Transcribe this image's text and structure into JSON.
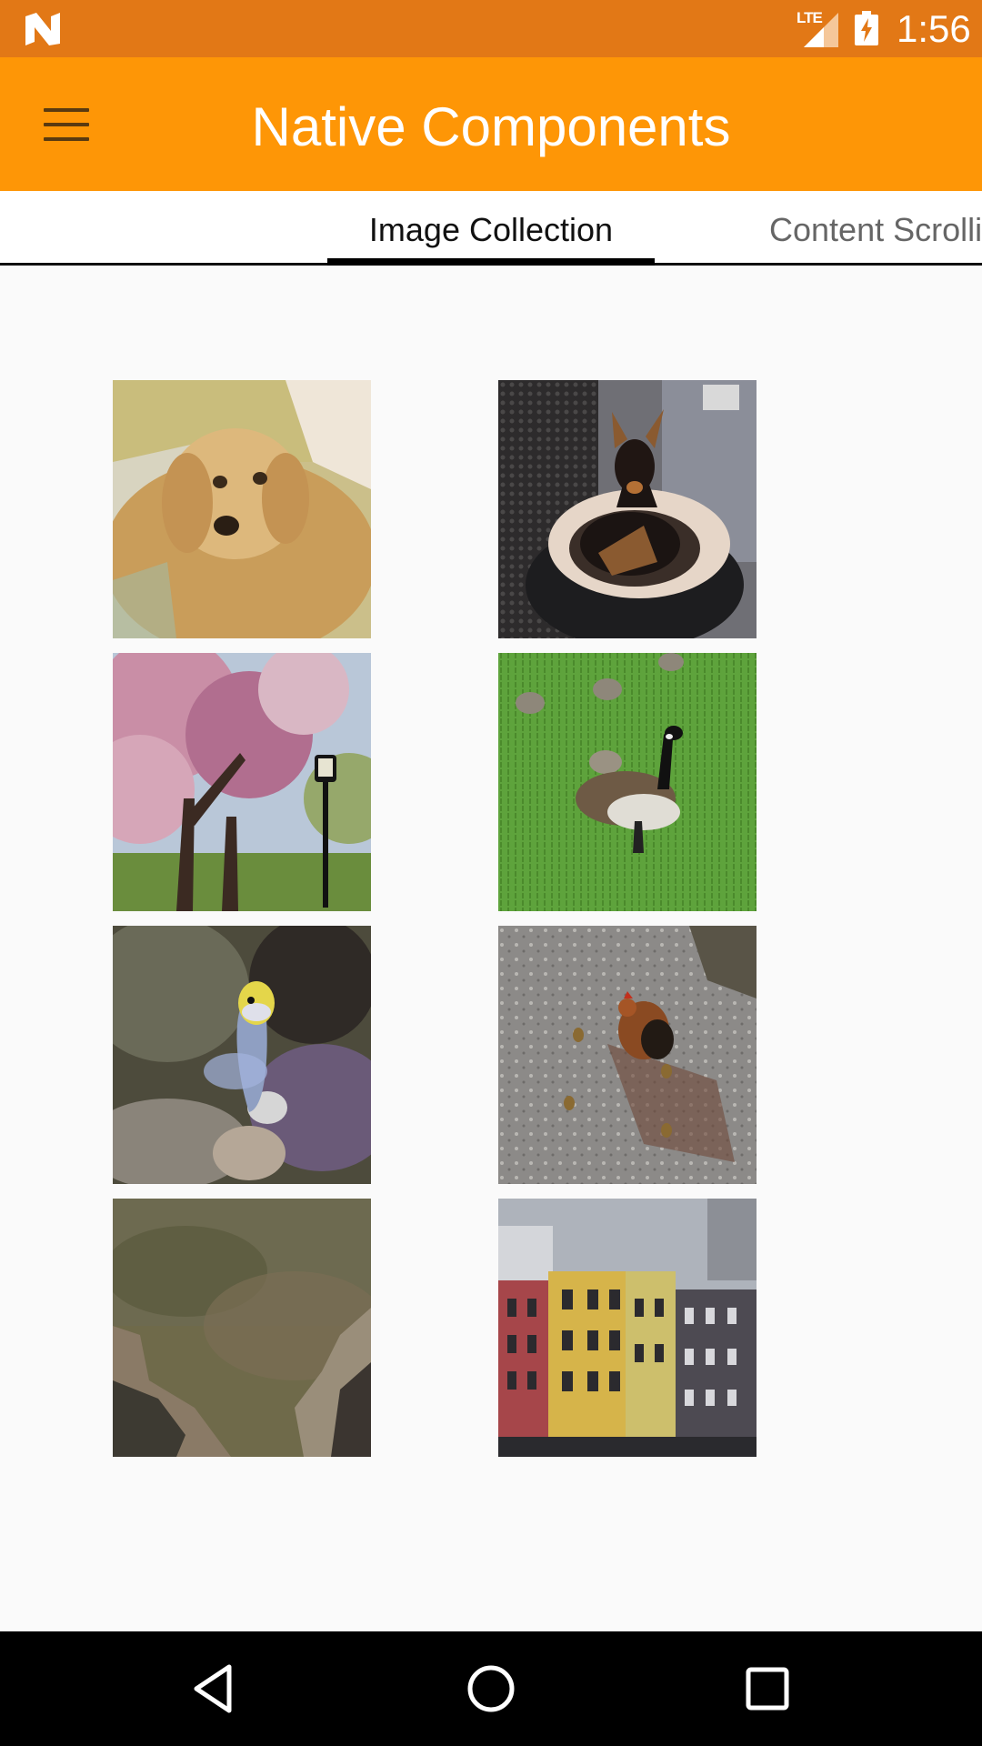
{
  "status_bar": {
    "time": "1:56",
    "network": "LTE",
    "icons": [
      "notification-n-icon",
      "lte-signal-icon",
      "battery-charging-icon"
    ]
  },
  "app_bar": {
    "title": "Native Components",
    "menu_icon": "hamburger-menu-icon"
  },
  "tabs": [
    {
      "label": "Image Collection",
      "active": true
    },
    {
      "label": "Content Scrolli",
      "active": false
    }
  ],
  "gallery": {
    "images": [
      {
        "subject": "fluffy-dog"
      },
      {
        "subject": "pinscher-dog"
      },
      {
        "subject": "blossom-trees"
      },
      {
        "subject": "canada-goose"
      },
      {
        "subject": "yellow-fish"
      },
      {
        "subject": "chicken-chicks"
      },
      {
        "subject": "rocky-water"
      },
      {
        "subject": "buildings"
      }
    ]
  },
  "nav_bar": {
    "buttons": [
      "back-icon",
      "home-icon",
      "recents-icon"
    ]
  },
  "colors": {
    "status_bar": "#e27816",
    "app_bar": "#fe9606",
    "background": "#fafafa",
    "nav_bar": "#000000"
  }
}
